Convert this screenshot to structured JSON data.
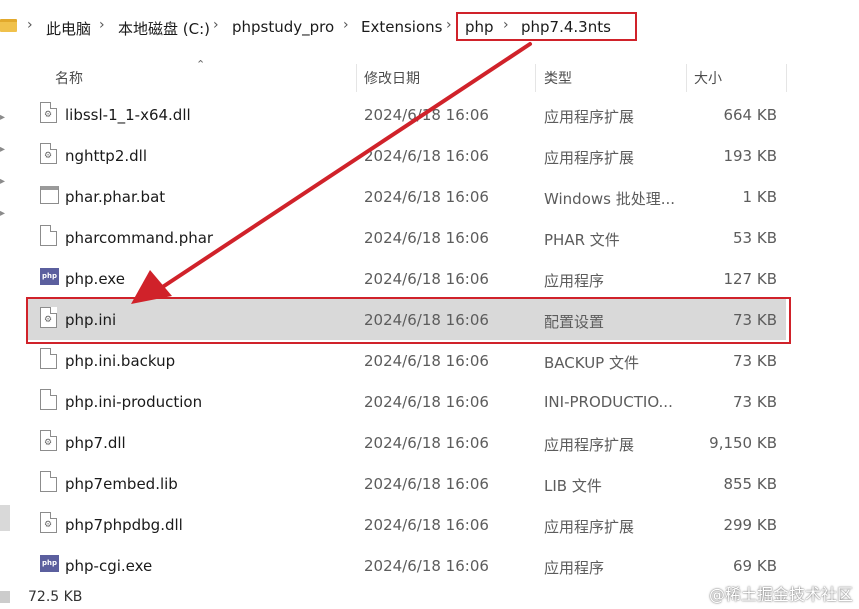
{
  "breadcrumb": {
    "items": [
      "此电脑",
      "本地磁盘 (C:)",
      "phpstudy_pro",
      "Extensions",
      "php",
      "php7.4.3nts"
    ],
    "separator": "›"
  },
  "columns": {
    "name": "名称",
    "date": "修改日期",
    "type": "类型",
    "size": "大小"
  },
  "files": [
    {
      "name": "libssl-1_1-x64.dll",
      "date": "2024/6/18 16:06",
      "type": "应用程序扩展",
      "size": "664 KB",
      "icon": "dll-icon"
    },
    {
      "name": "nghttp2.dll",
      "date": "2024/6/18 16:06",
      "type": "应用程序扩展",
      "size": "193 KB",
      "icon": "dll-icon"
    },
    {
      "name": "phar.phar.bat",
      "date": "2024/6/18 16:06",
      "type": "Windows 批处理...",
      "size": "1 KB",
      "icon": "bat-icon"
    },
    {
      "name": "pharcommand.phar",
      "date": "2024/6/18 16:06",
      "type": "PHAR 文件",
      "size": "53 KB",
      "icon": "file-icon"
    },
    {
      "name": "php.exe",
      "date": "2024/6/18 16:06",
      "type": "应用程序",
      "size": "127 KB",
      "icon": "exe-icon"
    },
    {
      "name": "php.ini",
      "date": "2024/6/18 16:06",
      "type": "配置设置",
      "size": "73 KB",
      "icon": "ini-icon"
    },
    {
      "name": "php.ini.backup",
      "date": "2024/6/18 16:06",
      "type": "BACKUP 文件",
      "size": "73 KB",
      "icon": "file-icon"
    },
    {
      "name": "php.ini-production",
      "date": "2024/6/18 16:06",
      "type": "INI-PRODUCTIO...",
      "size": "73 KB",
      "icon": "file-icon"
    },
    {
      "name": "php7.dll",
      "date": "2024/6/18 16:06",
      "type": "应用程序扩展",
      "size": "9,150 KB",
      "icon": "dll-icon"
    },
    {
      "name": "php7embed.lib",
      "date": "2024/6/18 16:06",
      "type": "LIB 文件",
      "size": "855 KB",
      "icon": "file-icon"
    },
    {
      "name": "php7phpdbg.dll",
      "date": "2024/6/18 16:06",
      "type": "应用程序扩展",
      "size": "299 KB",
      "icon": "dll-icon"
    },
    {
      "name": "php-cgi.exe",
      "date": "2024/6/18 16:06",
      "type": "应用程序",
      "size": "69 KB",
      "icon": "exe-icon"
    }
  ],
  "selected_file": "php.ini",
  "exe_icon_text": "php",
  "status_bar": {
    "selection_size": "72.5 KB"
  },
  "watermark": "@稀土掘金技术社区",
  "colors": {
    "highlight": "#d0222a",
    "selected_row": "#d9d9d9",
    "folder": "#f0c14b"
  }
}
